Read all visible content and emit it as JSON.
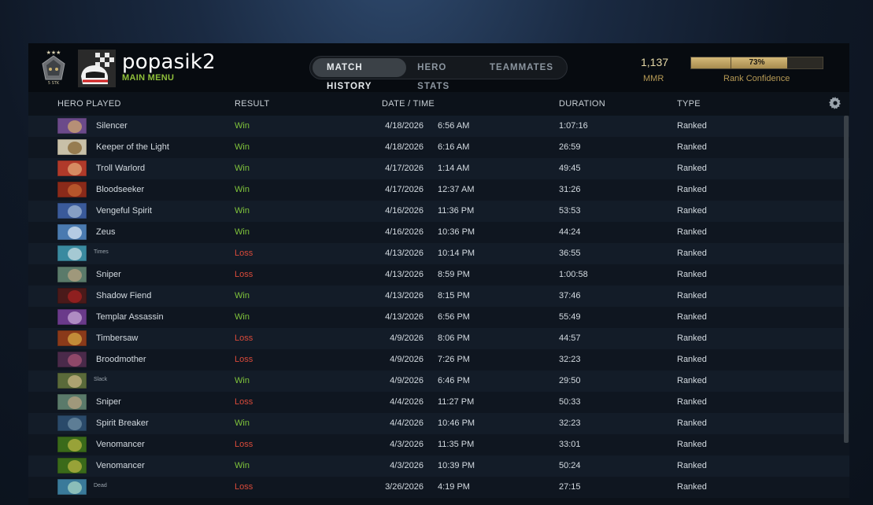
{
  "profile": {
    "name": "popasik2",
    "main_menu": "MAIN MENU",
    "medal_text": "5 STK"
  },
  "tabs": [
    {
      "label": "MATCH HISTORY",
      "active": true
    },
    {
      "label": "HERO STATS",
      "active": false
    },
    {
      "label": "TEAMMATES",
      "active": false
    }
  ],
  "mmr": {
    "value": "1,137",
    "label": "MMR"
  },
  "rank_confidence": {
    "percent_text": "73%",
    "fraction": 0.73,
    "label": "Rank Confidence"
  },
  "columns": {
    "hero": "HERO PLAYED",
    "result": "RESULT",
    "datetime": "DATE / TIME",
    "duration": "DURATION",
    "type": "TYPE"
  },
  "colors": {
    "win": "#7fc33b",
    "loss": "#d94a3a",
    "accent": "#8fbf3a",
    "gold": "#b69a55"
  },
  "matches": [
    {
      "hero": "Silencer",
      "result": "Win",
      "date": "4/18/2026",
      "time": "6:56 AM",
      "duration": "1:07:16",
      "type": "Ranked",
      "c1": "#6b4a8a",
      "c2": "#c9a070"
    },
    {
      "hero": "Keeper of the Light",
      "result": "Win",
      "date": "4/18/2026",
      "time": "6:16 AM",
      "duration": "26:59",
      "type": "Ranked",
      "c1": "#c8c0a8",
      "c2": "#8a6a3a"
    },
    {
      "hero": "Troll Warlord",
      "result": "Win",
      "date": "4/17/2026",
      "time": "1:14 AM",
      "duration": "49:45",
      "type": "Ranked",
      "c1": "#b03a2a",
      "c2": "#e0a070"
    },
    {
      "hero": "Bloodseeker",
      "result": "Win",
      "date": "4/17/2026",
      "time": "12:37 AM",
      "duration": "31:26",
      "type": "Ranked",
      "c1": "#8a2a1a",
      "c2": "#c06030"
    },
    {
      "hero": "Vengeful Spirit",
      "result": "Win",
      "date": "4/16/2026",
      "time": "11:36 PM",
      "duration": "53:53",
      "type": "Ranked",
      "c1": "#3a5a9a",
      "c2": "#9ab0d0"
    },
    {
      "hero": "Zeus",
      "result": "Win",
      "date": "4/16/2026",
      "time": "10:36 PM",
      "duration": "44:24",
      "type": "Ranked",
      "c1": "#4a7ab0",
      "c2": "#d0e0f0"
    },
    {
      "hero": "Times",
      "small": true,
      "result": "Loss",
      "date": "4/13/2026",
      "time": "10:14 PM",
      "duration": "36:55",
      "type": "Ranked",
      "c1": "#3a8aa0",
      "c2": "#c0d8e0"
    },
    {
      "hero": "Sniper",
      "result": "Loss",
      "date": "4/13/2026",
      "time": "8:59 PM",
      "duration": "1:00:58",
      "type": "Ranked",
      "c1": "#5a7a6a",
      "c2": "#b0a080"
    },
    {
      "hero": "Shadow Fiend",
      "result": "Win",
      "date": "4/13/2026",
      "time": "8:15 PM",
      "duration": "37:46",
      "type": "Ranked",
      "c1": "#4a1a1a",
      "c2": "#a02020"
    },
    {
      "hero": "Templar Assassin",
      "result": "Win",
      "date": "4/13/2026",
      "time": "6:56 PM",
      "duration": "55:49",
      "type": "Ranked",
      "c1": "#6a3a8a",
      "c2": "#c0a0d0"
    },
    {
      "hero": "Timbersaw",
      "result": "Loss",
      "date": "4/9/2026",
      "time": "8:06 PM",
      "duration": "44:57",
      "type": "Ranked",
      "c1": "#8a3a1a",
      "c2": "#d0a040"
    },
    {
      "hero": "Broodmother",
      "result": "Loss",
      "date": "4/9/2026",
      "time": "7:26 PM",
      "duration": "32:23",
      "type": "Ranked",
      "c1": "#4a2a4a",
      "c2": "#a05070"
    },
    {
      "hero": "Slack",
      "small": true,
      "result": "Win",
      "date": "4/9/2026",
      "time": "6:46 PM",
      "duration": "29:50",
      "type": "Ranked",
      "c1": "#5a6a3a",
      "c2": "#c0b080"
    },
    {
      "hero": "Sniper",
      "result": "Loss",
      "date": "4/4/2026",
      "time": "11:27 PM",
      "duration": "50:33",
      "type": "Ranked",
      "c1": "#5a7a6a",
      "c2": "#b0a080"
    },
    {
      "hero": "Spirit Breaker",
      "result": "Win",
      "date": "4/4/2026",
      "time": "10:46 PM",
      "duration": "32:23",
      "type": "Ranked",
      "c1": "#2a4a6a",
      "c2": "#6a8aa0"
    },
    {
      "hero": "Venomancer",
      "result": "Loss",
      "date": "4/3/2026",
      "time": "11:35 PM",
      "duration": "33:01",
      "type": "Ranked",
      "c1": "#3a6a1a",
      "c2": "#b0b040"
    },
    {
      "hero": "Venomancer",
      "result": "Win",
      "date": "4/3/2026",
      "time": "10:39 PM",
      "duration": "50:24",
      "type": "Ranked",
      "c1": "#3a6a1a",
      "c2": "#b0b040"
    },
    {
      "hero": "Dead",
      "small": true,
      "result": "Loss",
      "date": "3/26/2026",
      "time": "4:19 PM",
      "duration": "27:15",
      "type": "Ranked",
      "c1": "#3a7a9a",
      "c2": "#a0d0c0"
    }
  ]
}
